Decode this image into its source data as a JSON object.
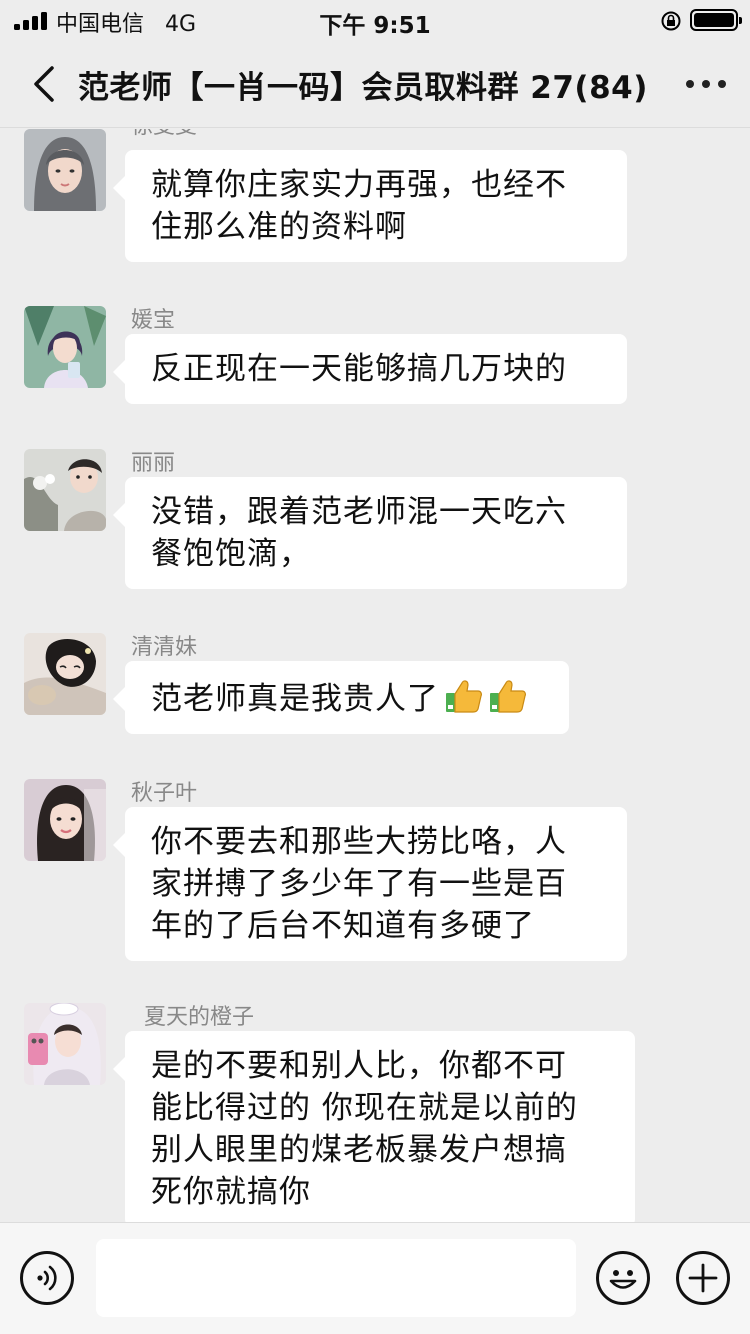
{
  "status_bar": {
    "carrier": "中国电信",
    "network": "4G",
    "time": "下午 9:51",
    "signal_bars": 4,
    "battery_level": 0.95
  },
  "nav": {
    "title": "范老师【一肖一码】会员取料群 27(84)",
    "back_icon": "chevron-left-icon",
    "more_icon": "more-dots-icon"
  },
  "messages": [
    {
      "sender": "徐斐斐",
      "lines": [
        "就算你庄家实力再强，也经不",
        "住那么准的资料啊"
      ]
    },
    {
      "sender": "媛宝",
      "lines": [
        "反正现在一天能够搞几万块的"
      ]
    },
    {
      "sender": "丽丽",
      "lines": [
        "没错，跟着范老师混一天吃六",
        "餐饱饱滴，"
      ]
    },
    {
      "sender": "清清妹",
      "lines": [
        "范老师真是我贵人了"
      ],
      "emoji": [
        "thumbs-up-icon",
        "thumbs-up-icon"
      ]
    },
    {
      "sender": "秋子叶",
      "lines": [
        "你不要去和那些大捞比咯，人",
        "家拼搏了多少年了有一些是百",
        "年的了后台不知道有多硬了"
      ]
    },
    {
      "sender": "夏天的橙子",
      "lines": [
        "是的不要和别人比，你都不可",
        "能比得过的 你现在就是以前的",
        "别人眼里的煤老板暴发户想搞",
        "死你就搞你"
      ]
    }
  ],
  "input_bar": {
    "voice_icon": "voice-icon",
    "emoji_icon": "emoji-icon",
    "plus_icon": "plus-icon",
    "text_value": ""
  },
  "colors": {
    "background": "#ededed",
    "bubble": "#ffffff",
    "sender_name": "#888888"
  }
}
